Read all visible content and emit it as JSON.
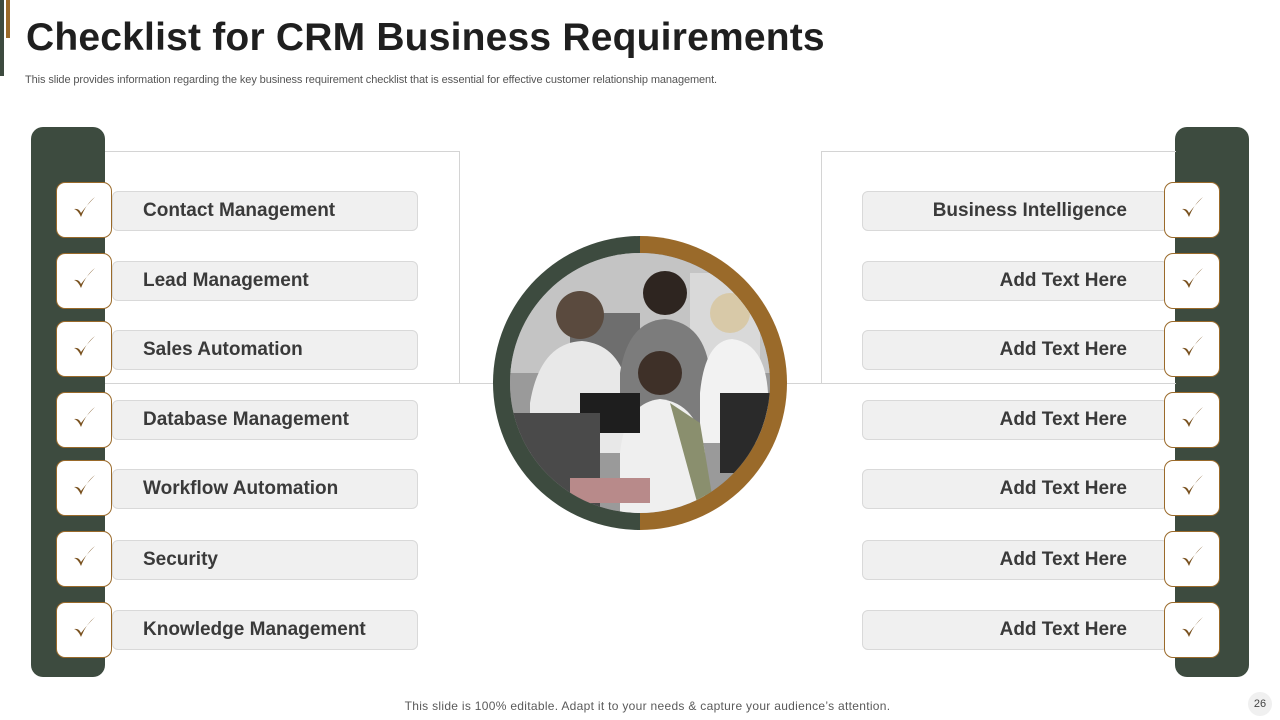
{
  "title": "Checklist for CRM Business Requirements",
  "subtitle": "This slide provides information regarding the key business requirement checklist that is essential for effective customer relationship management.",
  "left_items": [
    "Contact Management",
    "Lead Management",
    "Sales Automation",
    "Database Management",
    "Workflow Automation",
    "Security",
    "Knowledge Management"
  ],
  "right_items": [
    "Business Intelligence",
    "Add Text Here",
    "Add Text Here",
    "Add Text Here",
    "Add Text Here",
    "Add Text Here",
    "Add Text Here"
  ],
  "footer": "This slide is 100% editable. Adapt it to your needs & capture your audience’s attention.",
  "page_number": "26",
  "colors": {
    "dark_green": "#3d4b3f",
    "brown": "#9a6a2a",
    "pill_bg": "#f0f0f0"
  },
  "icons": {
    "check": "check-icon",
    "center_image": "team-photo"
  }
}
